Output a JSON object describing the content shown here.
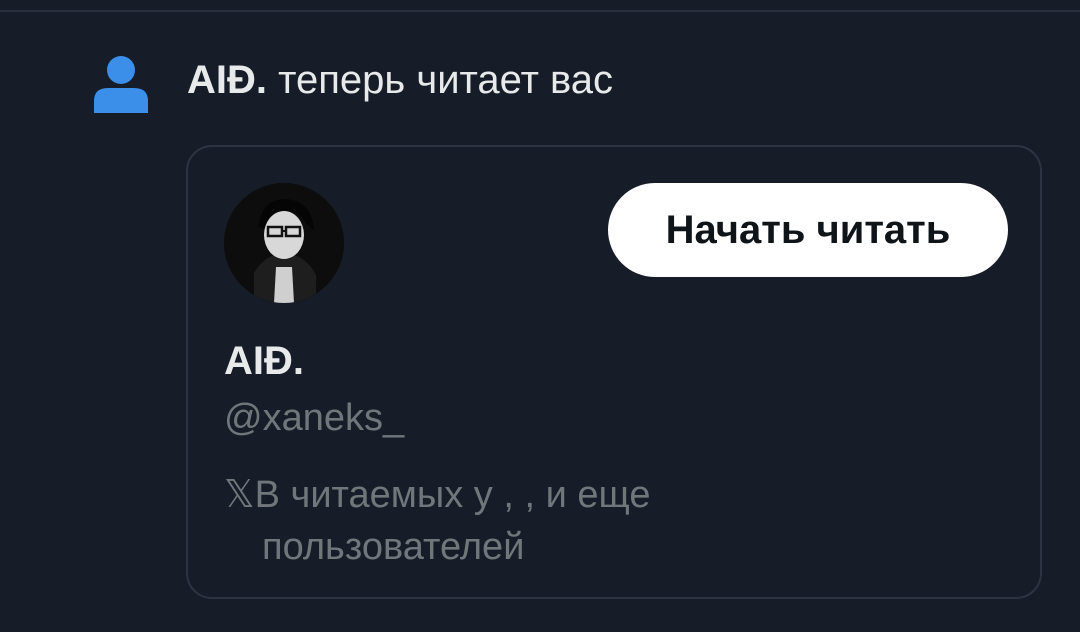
{
  "notification": {
    "icon": "person-icon",
    "icon_color": "#3b8fe8",
    "name": "AIĐ.",
    "text": "теперь читает вас"
  },
  "card": {
    "avatar": "profile-avatar",
    "follow_button_label": "Начать читать",
    "display_name": "AIĐ.",
    "handle": "@xaneks_",
    "followed_by_prefix": "𝕏",
    "followed_by_line1": "В читаемых у , , и еще",
    "followed_by_line2": "пользователей"
  },
  "colors": {
    "background": "#161d28",
    "primary_text": "#e7e9ea",
    "secondary_text": "#71767b",
    "border": "#2b3440",
    "button_bg": "#ffffff",
    "button_text": "#0f1419"
  }
}
